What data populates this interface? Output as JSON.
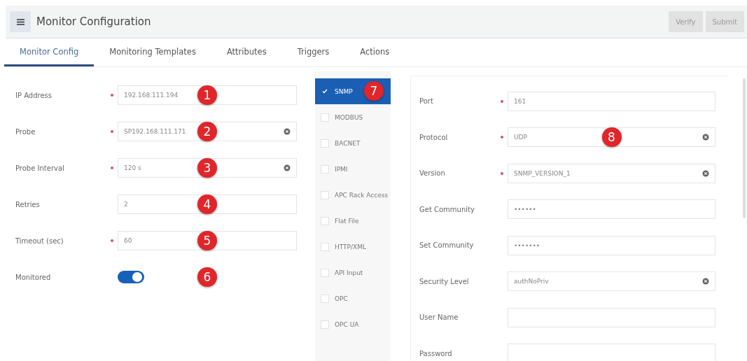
{
  "header": {
    "title": "Monitor Configuration",
    "buttons": [
      {
        "label": "Verify",
        "disabled": true
      },
      {
        "label": "Submit",
        "disabled": true
      }
    ]
  },
  "tabs": [
    {
      "label": "Monitor Config",
      "selected": true
    },
    {
      "label": "Monitoring Templates",
      "selected": false
    },
    {
      "label": "Attributes",
      "selected": false
    },
    {
      "label": "Triggers",
      "selected": false
    },
    {
      "label": "Actions",
      "selected": false
    }
  ],
  "general_fields": [
    {
      "label": "IP Address",
      "kind": "text",
      "required": true,
      "value": "192.168.111.194",
      "badge": "1"
    },
    {
      "label": "Probe",
      "kind": "select",
      "required": true,
      "value": "SP192.168.111.171",
      "badge": "2"
    },
    {
      "label": "Probe Interval",
      "kind": "select",
      "required": true,
      "value": "120 s",
      "badge": "3"
    },
    {
      "label": "Retries",
      "kind": "text",
      "required": false,
      "value": "2",
      "badge": "4"
    },
    {
      "label": "Timeout (sec)",
      "kind": "text",
      "required": true,
      "value": "60",
      "badge": "5"
    },
    {
      "label": "Monitored",
      "kind": "toggle",
      "on": true,
      "badge": "6"
    }
  ],
  "protocols": [
    {
      "label": "SNMP",
      "selected": true,
      "badge": "7"
    },
    {
      "label": "MODBUS",
      "selected": false
    },
    {
      "label": "BACNET",
      "selected": false
    },
    {
      "label": "IPMI",
      "selected": false
    },
    {
      "label": "APC Rack Access",
      "selected": false
    },
    {
      "label": "Flat File",
      "selected": false
    },
    {
      "label": "HTTP/XML",
      "selected": false
    },
    {
      "label": "API Input",
      "selected": false
    },
    {
      "label": "OPC",
      "selected": false
    },
    {
      "label": "OPC UA",
      "selected": false
    }
  ],
  "snmp_fields": [
    {
      "label": "Port",
      "kind": "text",
      "required": true,
      "value": "161"
    },
    {
      "label": "Protocol",
      "kind": "select",
      "required": true,
      "value": "UDP",
      "badge": "8"
    },
    {
      "label": "Version",
      "kind": "select",
      "required": true,
      "value": "SNMP_VERSION_1"
    },
    {
      "label": "Get Community",
      "kind": "text",
      "required": false,
      "value": "••••••"
    },
    {
      "label": "Set Community",
      "kind": "text",
      "required": false,
      "value": "•••••••"
    },
    {
      "label": "Security Level",
      "kind": "select",
      "required": false,
      "value": "authNoPriv"
    },
    {
      "label": "User Name",
      "kind": "text",
      "required": false
    },
    {
      "label": "Password",
      "kind": "text",
      "required": false
    }
  ]
}
